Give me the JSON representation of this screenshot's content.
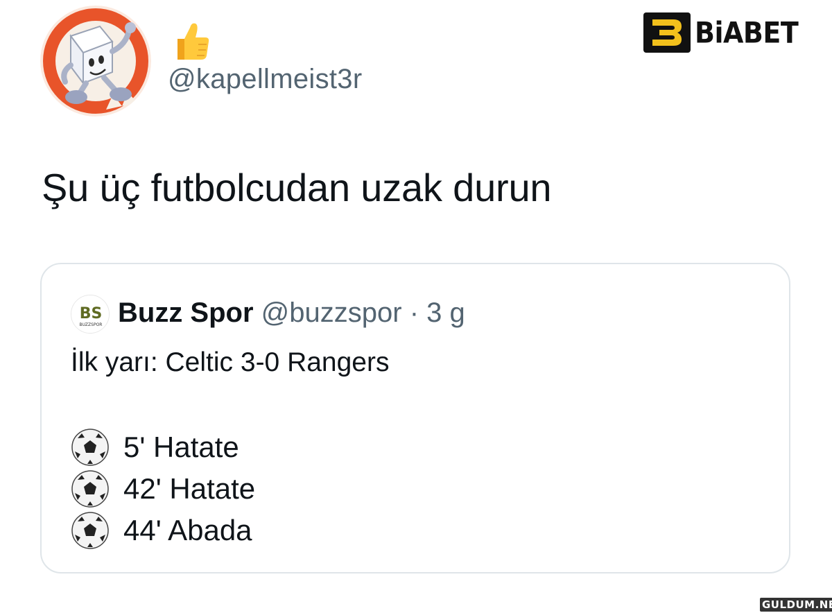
{
  "author": {
    "handle": "@kapellmeist3r",
    "avatar_icon": "cartoon-sugar-cube-avatar",
    "reaction_emoji": "thumbs-up-emoji"
  },
  "brand": {
    "logo_icon": "biabet-logo",
    "name": "BiABET"
  },
  "tweet": {
    "text": "Şu üç futbolcudan uzak durun"
  },
  "quoted_tweet": {
    "avatar_icon": "buzz-spor-logo",
    "display_name": "Buzz Spor",
    "meta": "@buzzspor · 3 g",
    "first_line": "İlk yarı: Celtic 3-0 Rangers",
    "goals": [
      {
        "icon": "soccer-ball-icon",
        "text": "5' Hatate"
      },
      {
        "icon": "soccer-ball-icon",
        "text": "42' Hatate"
      },
      {
        "icon": "soccer-ball-icon",
        "text": "44' Abada"
      }
    ]
  },
  "watermark": {
    "text": "GULDUM.NET"
  },
  "colors": {
    "text": "#0f1419",
    "secondary": "#536471",
    "border": "#dfe5e9",
    "avatar_bg": "#e8542a"
  }
}
